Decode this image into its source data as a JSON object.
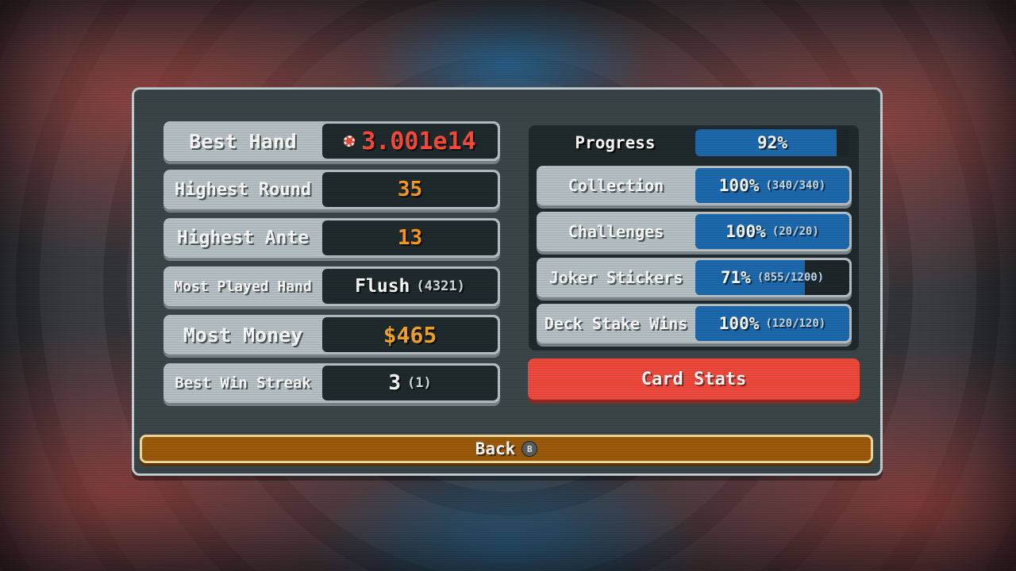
{
  "stats": [
    {
      "label": "Best Hand",
      "value": "3.001e14",
      "sub": "",
      "color": "#ff4a3a",
      "icon": "chip-icon"
    },
    {
      "label": "Highest Round",
      "value": "35",
      "sub": "",
      "color": "#ff9a1f"
    },
    {
      "label": "Highest Ante",
      "value": "13",
      "sub": "",
      "color": "#ff9a1f"
    },
    {
      "label": "Most Played Hand",
      "value": "Flush",
      "sub": "(4321)",
      "color": "#ffffff"
    },
    {
      "label": "Most Money",
      "value": "$465",
      "sub": "",
      "color": "#f4a52a"
    },
    {
      "label": "Best Win Streak",
      "value": "3",
      "sub": "(1)",
      "color": "#ffffff"
    }
  ],
  "progress": {
    "label": "Progress",
    "value": "92%",
    "fraction": 0.92
  },
  "collections": [
    {
      "label": "Collection",
      "value": "100%",
      "detail": "(340/340)",
      "fraction": 1.0
    },
    {
      "label": "Challenges",
      "value": "100%",
      "detail": "(20/20)",
      "fraction": 1.0
    },
    {
      "label": "Joker Stickers",
      "value": "71%",
      "detail": "(855/1200)",
      "fraction": 0.71
    },
    {
      "label": "Deck Stake Wins",
      "value": "100%",
      "detail": "(120/120)",
      "fraction": 1.0
    }
  ],
  "card_stats_label": "Card Stats",
  "back_label": "Back",
  "back_button_hint": "B",
  "colors": {
    "accent_red": "#f04a3c",
    "bar_blue": "#1d69ad",
    "back_orange": "#9c5b0b"
  }
}
